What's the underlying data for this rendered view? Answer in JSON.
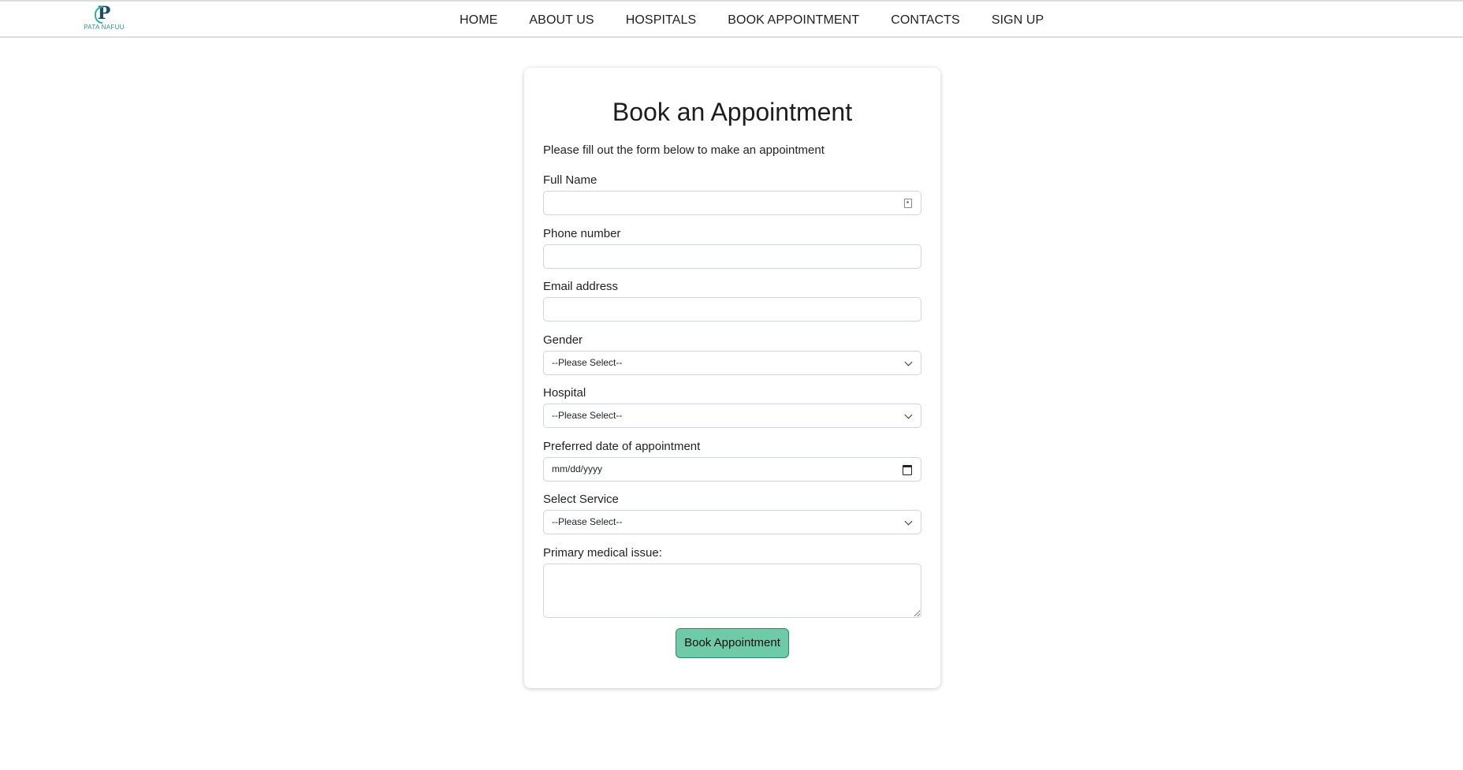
{
  "brand": {
    "logo_letter": "P",
    "logo_name": "PATA NAFUU"
  },
  "nav": {
    "items": [
      "HOME",
      "ABOUT US",
      "HOSPITALS",
      "BOOK APPOINTMENT",
      "CONTACTS",
      "SIGN UP"
    ]
  },
  "form": {
    "title": "Book an Appointment",
    "intro": "Please fill out the form below to make an appointment",
    "full_name_label": "Full Name",
    "full_name_value": "",
    "phone_label": "Phone number",
    "phone_value": "",
    "email_label": "Email address",
    "email_value": "",
    "gender_label": "Gender",
    "gender_selected": "--Please Select--",
    "hospital_label": "Hospital",
    "hospital_selected": "--Please Select--",
    "date_label": "Preferred date of appointment",
    "date_value": "mm/dd/yyyy",
    "service_label": "Select Service",
    "service_selected": "--Please Select--",
    "issue_label": "Primary medical issue:",
    "issue_value": "",
    "submit_label": "Book Appointment"
  },
  "colors": {
    "button_bg": "#6fcaa8",
    "button_border": "#2c8a66",
    "brand_primary": "#1c4e6b",
    "brand_accent": "#2bb3a0"
  }
}
